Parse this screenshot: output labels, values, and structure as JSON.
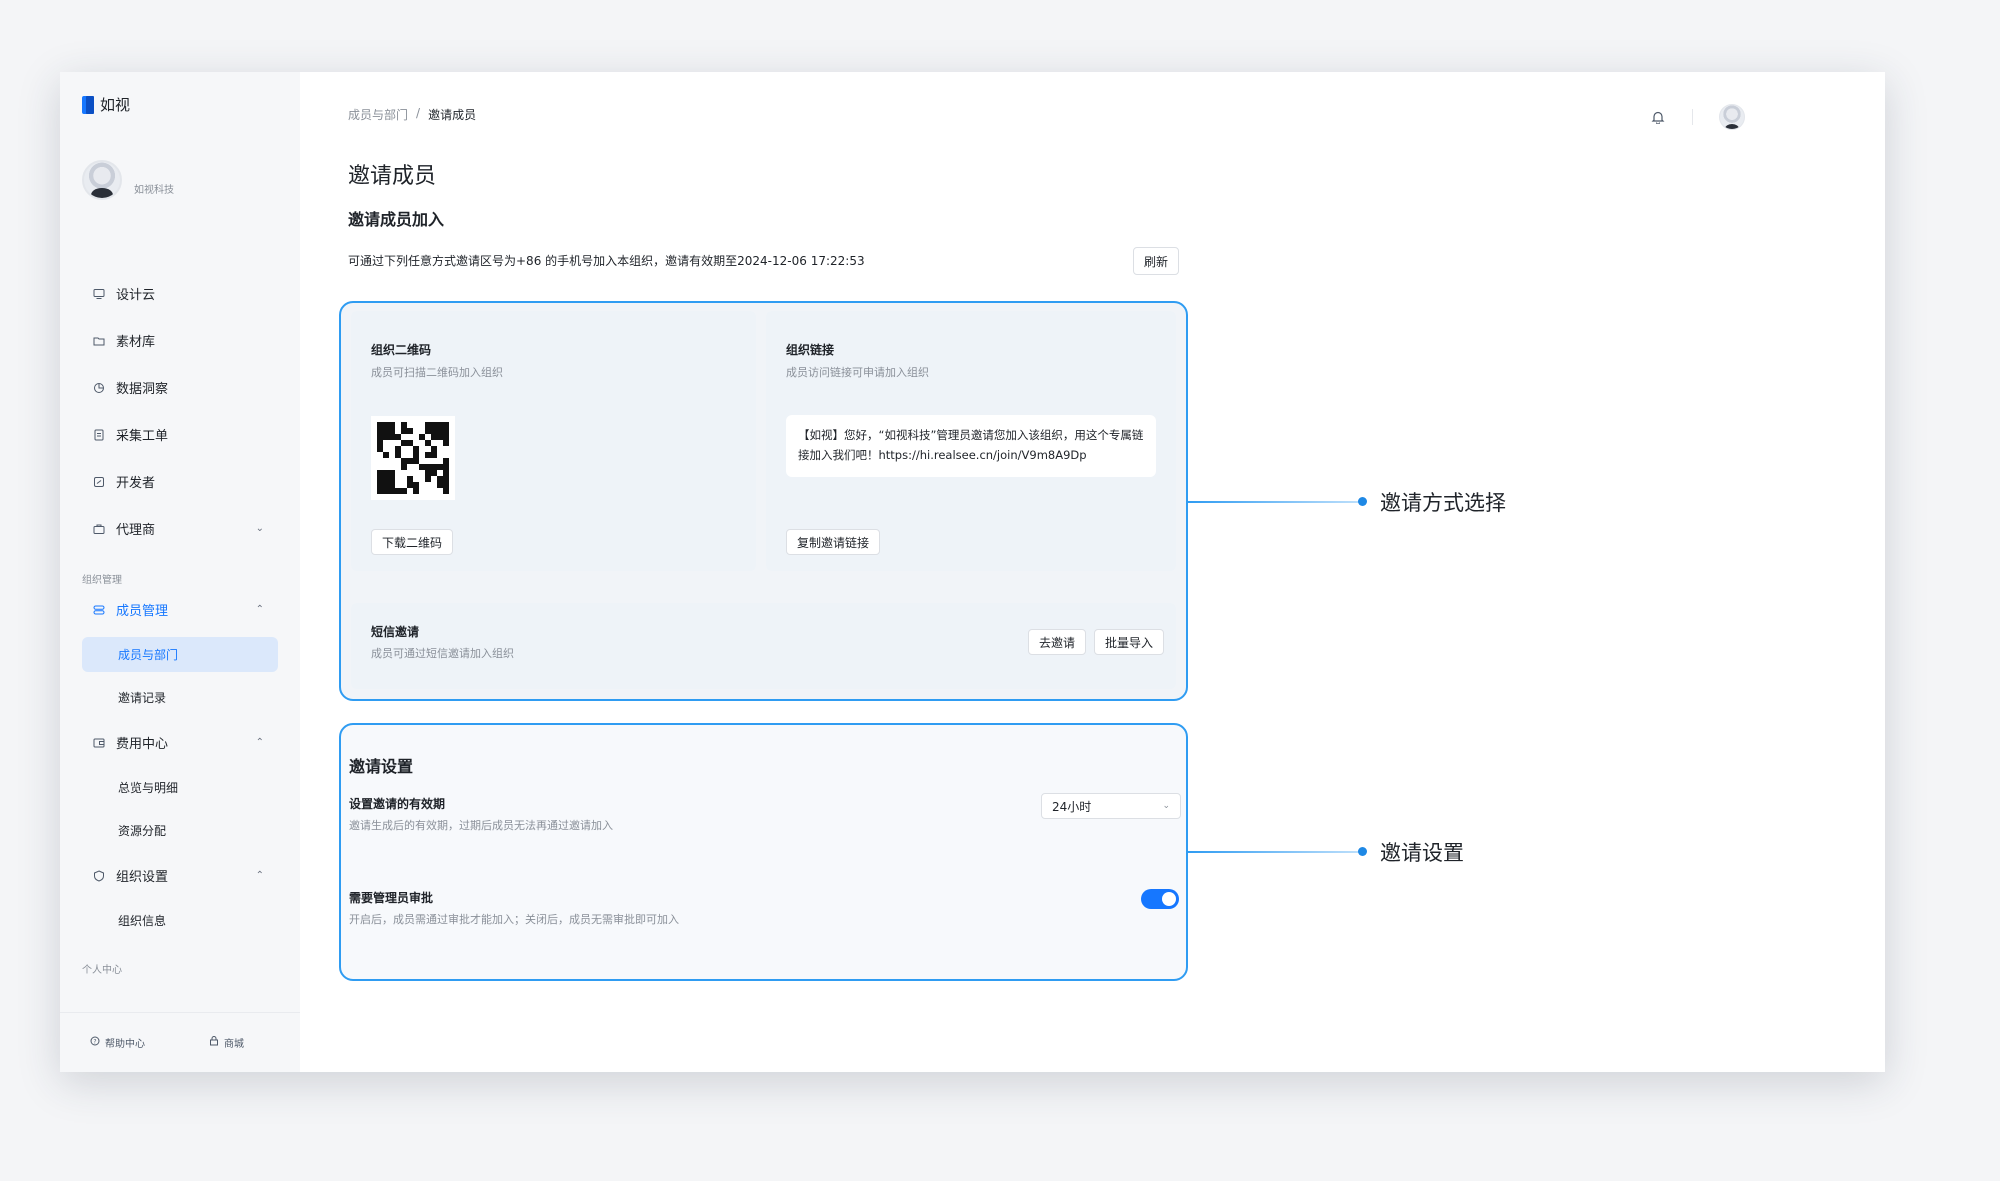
{
  "app": {
    "name": "如视"
  },
  "org": {
    "name": "如视科技"
  },
  "nav": {
    "items": [
      {
        "label": "设计云",
        "icon": "monitor-icon"
      },
      {
        "label": "素材库",
        "icon": "folder-icon"
      },
      {
        "label": "数据洞察",
        "icon": "pie-chart-icon"
      },
      {
        "label": "采集工单",
        "icon": "document-icon"
      },
      {
        "label": "开发者",
        "icon": "code-icon"
      },
      {
        "label": "代理商",
        "icon": "briefcase-icon"
      }
    ],
    "group_org": "组织管理",
    "members": {
      "label": "成员管理",
      "subs": [
        "成员与部门",
        "邀请记录"
      ]
    },
    "billing": {
      "label": "费用中心",
      "subs": [
        "总览与明细",
        "资源分配"
      ]
    },
    "org_settings": {
      "label": "组织设置",
      "subs": [
        "组织信息"
      ]
    },
    "group_personal": "个人中心",
    "footer": {
      "help": "帮助中心",
      "shop": "商城"
    }
  },
  "breadcrumb": {
    "parent": "成员与部门",
    "sep": "/",
    "current": "邀请成员"
  },
  "page": {
    "title": "邀请成员",
    "section_title": "邀请成员加入",
    "description": "可通过下列任意方式邀请区号为+86 的手机号加入本组织，邀请有效期至2024-12-06 17:22:53",
    "refresh_label": "刷新"
  },
  "qr_panel": {
    "title": "组织二维码",
    "subtitle": "成员可扫描二维码加入组织",
    "download_label": "下载二维码"
  },
  "link_panel": {
    "title": "组织链接",
    "subtitle": "成员访问链接可申请加入组织",
    "invite_text": "【如视】您好，“如视科技”管理员邀请您加入该组织，用这个专属链接加入我们吧！https://hi.realsee.cn/join/V9m8A9Dp",
    "copy_label": "复制邀请链接"
  },
  "sms_panel": {
    "title": "短信邀请",
    "subtitle": "成员可通过短信邀请加入组织",
    "invite_label": "去邀请",
    "batch_label": "批量导入"
  },
  "settings": {
    "title": "邀请设置",
    "validity_title": "设置邀请的有效期",
    "validity_sub": "邀请生成后的有效期，过期后成员无法再通过邀请加入",
    "validity_value": "24小时",
    "approval_title": "需要管理员审批",
    "approval_sub": "开启后，成员需通过审批才能加入；关闭后，成员无需审批即可加入",
    "approval_on": true
  },
  "callouts": {
    "methods": "邀请方式选择",
    "settings": "邀请设置"
  },
  "colors": {
    "accent": "#1677ff",
    "callout_border": "#2f9cf2"
  }
}
